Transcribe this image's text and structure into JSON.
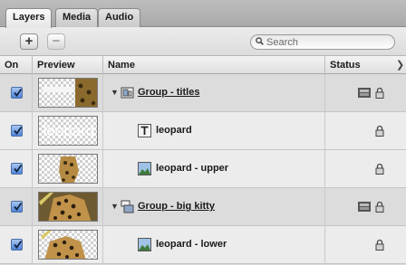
{
  "tabs": [
    {
      "label": "Layers"
    },
    {
      "label": "Media"
    },
    {
      "label": "Audio"
    }
  ],
  "toolbar": {
    "add_label": "+",
    "remove_label": "−"
  },
  "search": {
    "placeholder": "Search"
  },
  "columns": [
    {
      "label": "On"
    },
    {
      "label": "Preview"
    },
    {
      "label": "Name"
    },
    {
      "label": "Status"
    }
  ],
  "rows": [
    {
      "name": "Group - titles",
      "type": "group",
      "enabled": true,
      "expanded": true,
      "preview": "mixed",
      "icons": [
        "group-icon"
      ],
      "status": [
        "film-icon",
        "lock-icon"
      ]
    },
    {
      "name": "leopard",
      "type": "text",
      "enabled": true,
      "preview_text": "leopard",
      "icons": [
        "text-layer-icon"
      ],
      "status": [
        "lock-icon"
      ]
    },
    {
      "name": "leopard - upper",
      "type": "image",
      "enabled": true,
      "preview": "partial",
      "icons": [
        "image-layer-icon"
      ],
      "status": [
        "lock-icon"
      ]
    },
    {
      "name": "Group - big kitty",
      "type": "group",
      "enabled": true,
      "expanded": true,
      "preview": "full",
      "icons": [
        "group-icon"
      ],
      "status": [
        "film-icon",
        "lock-icon"
      ]
    },
    {
      "name": "leopard - lower",
      "type": "image",
      "enabled": true,
      "preview": "partial",
      "icons": [
        "image-layer-icon"
      ],
      "status": [
        "lock-icon"
      ]
    }
  ],
  "colors": {
    "checkbox": "#4f83d6",
    "group_row": "#dcdcdc",
    "item_row": "#ececec"
  }
}
